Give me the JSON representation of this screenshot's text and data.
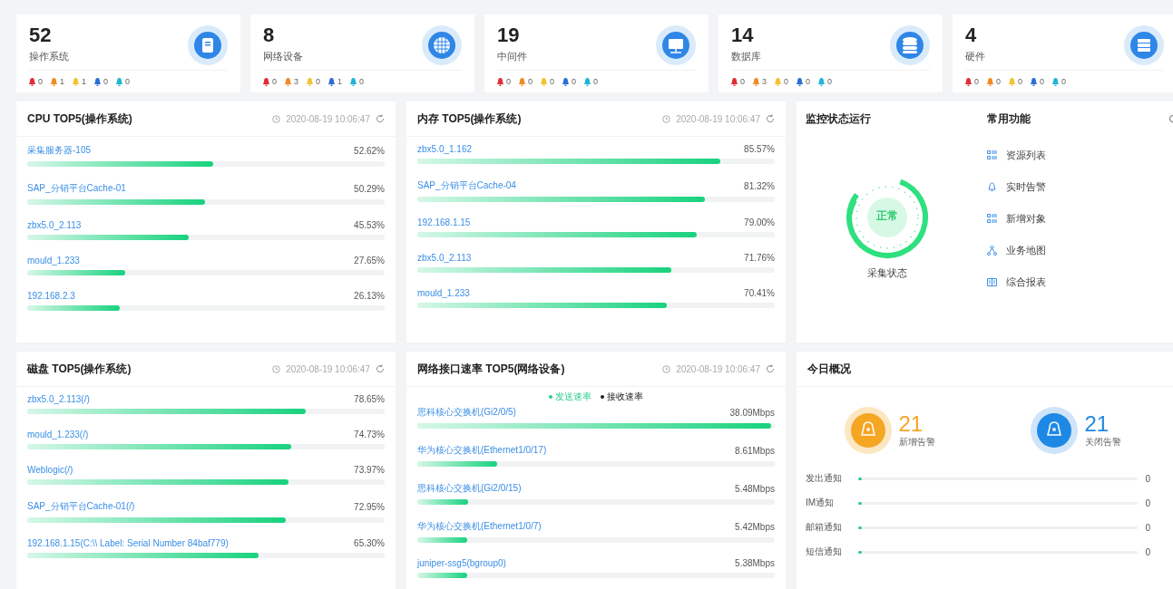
{
  "summary_cards": [
    {
      "count": "52",
      "label": "操作系统",
      "kind": "os",
      "alerts": [
        {
          "count": "0",
          "color": "#e02d37"
        },
        {
          "count": "1",
          "color": "#f08a24"
        },
        {
          "count": "1",
          "color": "#f2c230"
        },
        {
          "count": "0",
          "color": "#2a6fd6"
        },
        {
          "count": "0",
          "color": "#22b4d8"
        }
      ]
    },
    {
      "count": "8",
      "label": "网络设备",
      "kind": "network",
      "alerts": [
        {
          "count": "0",
          "color": "#e02d37"
        },
        {
          "count": "3",
          "color": "#f08a24"
        },
        {
          "count": "0",
          "color": "#f2c230"
        },
        {
          "count": "1",
          "color": "#2a6fd6"
        },
        {
          "count": "0",
          "color": "#22b4d8"
        }
      ]
    },
    {
      "count": "19",
      "label": "中间件",
      "kind": "middleware",
      "alerts": [
        {
          "count": "0",
          "color": "#e02d37"
        },
        {
          "count": "0",
          "color": "#f08a24"
        },
        {
          "count": "0",
          "color": "#f2c230"
        },
        {
          "count": "0",
          "color": "#2a6fd6"
        },
        {
          "count": "0",
          "color": "#22b4d8"
        }
      ]
    },
    {
      "count": "14",
      "label": "数据库",
      "kind": "database",
      "alerts": [
        {
          "count": "0",
          "color": "#e02d37"
        },
        {
          "count": "3",
          "color": "#f08a24"
        },
        {
          "count": "0",
          "color": "#f2c230"
        },
        {
          "count": "0",
          "color": "#2a6fd6"
        },
        {
          "count": "0",
          "color": "#22b4d8"
        }
      ]
    },
    {
      "count": "4",
      "label": "硬件",
      "kind": "hardware",
      "alerts": [
        {
          "count": "0",
          "color": "#e02d37"
        },
        {
          "count": "0",
          "color": "#f08a24"
        },
        {
          "count": "0",
          "color": "#f2c230"
        },
        {
          "count": "0",
          "color": "#2a6fd6"
        },
        {
          "count": "0",
          "color": "#22b4d8"
        }
      ]
    }
  ],
  "cpu_top5": {
    "title": "CPU TOP5(操作系统)",
    "timestamp": "2020-08-19 10:06:47",
    "rows": [
      {
        "name": "采集服务器-105",
        "value": "52.62%",
        "level": 0.5262
      },
      {
        "name": "SAP_分销平台Cache-01",
        "value": "50.29%",
        "level": 0.5029
      },
      {
        "name": "zbx5.0_2.113",
        "value": "45.53%",
        "level": 0.4553
      },
      {
        "name": "mould_1.233",
        "value": "27.65%",
        "level": 0.2765
      },
      {
        "name": "192.168.2.3",
        "value": "26.13%",
        "level": 0.2613
      }
    ]
  },
  "memory_top5": {
    "title": "内存 TOP5(操作系统)",
    "timestamp": "2020-08-19 10:06:47",
    "rows": [
      {
        "name": "zbx5.0_1.162",
        "value": "85.57%",
        "level": 0.8557
      },
      {
        "name": "SAP_分销平台Cache-04",
        "value": "81.32%",
        "level": 0.8132
      },
      {
        "name": "192.168.1.15",
        "value": "79.00%",
        "level": 0.79
      },
      {
        "name": "zbx5.0_2.113",
        "value": "71.76%",
        "level": 0.7176
      },
      {
        "name": "mould_1.233",
        "value": "70.41%",
        "level": 0.7041
      }
    ]
  },
  "monitor_status": {
    "title": "监控状态运行",
    "status": "正常",
    "label": "采集状态"
  },
  "common_functions": {
    "title": "常用功能",
    "items": [
      {
        "label": "资源列表",
        "kind": "list"
      },
      {
        "label": "实时告警",
        "kind": "bell"
      },
      {
        "label": "新增对象",
        "kind": "list"
      },
      {
        "label": "业务地图",
        "kind": "map"
      },
      {
        "label": "综合报表",
        "kind": "report"
      }
    ]
  },
  "disk_top5": {
    "title": "磁盘 TOP5(操作系统)",
    "timestamp": "2020-08-19 10:06:47",
    "rows": [
      {
        "name": "zbx5.0_2.113(/)",
        "value": "78.65%",
        "level": 0.7865
      },
      {
        "name": "mould_1.233(/)",
        "value": "74.73%",
        "level": 0.7473
      },
      {
        "name": "Weblogic(/)",
        "value": "73.97%",
        "level": 0.7397
      },
      {
        "name": "SAP_分销平台Cache-01(/)",
        "value": "72.95%",
        "level": 0.7295
      },
      {
        "name": "192.168.1.15(C:\\\\ Label: Serial Number 84baf779)",
        "value": "65.30%",
        "level": 0.653
      }
    ]
  },
  "network_top5": {
    "title": "网络接口速率 TOP5(网络设备)",
    "timestamp": "2020-08-19 10:06:47",
    "legend": [
      {
        "label": "发送速率",
        "color": "#2ecc8a"
      },
      {
        "label": "接收速率",
        "color": "#222222"
      }
    ],
    "rows": [
      {
        "name": "思科核心交换机(Gi2/0/5)",
        "value": "38.09Mbps",
        "level": 1
      },
      {
        "name": "华为核心交换机(Ethernet1/0/17)",
        "value": "8.61Mbps",
        "level": 0.226
      },
      {
        "name": "思科核心交换机(Gi2/0/15)",
        "value": "5.48Mbps",
        "level": 0.144
      },
      {
        "name": "华为核心交换机(Ethernet1/0/7)",
        "value": "5.42Mbps",
        "level": 0.142
      },
      {
        "name": "juniper-ssg5(bgroup0)",
        "value": "5.38Mbps",
        "level": 0.141
      }
    ]
  },
  "today_overview": {
    "title": "今日概况",
    "stats": [
      {
        "count": "21",
        "label": "新增告警",
        "kind": "new"
      },
      {
        "count": "21",
        "label": "关闭告警",
        "kind": "closed"
      }
    ],
    "notifications": [
      {
        "label": "发出通知",
        "value": "0",
        "level": 0
      },
      {
        "label": "IM通知",
        "value": "0",
        "level": 0
      },
      {
        "label": "邮箱通知",
        "value": "0",
        "level": 0
      },
      {
        "label": "短信通知",
        "value": "0",
        "level": 0
      }
    ]
  }
}
